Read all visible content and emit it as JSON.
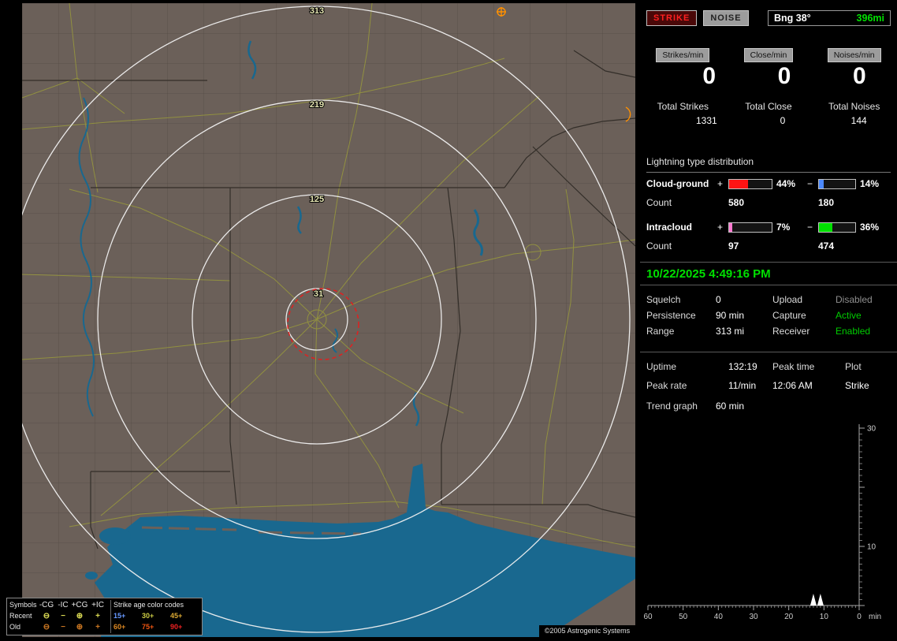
{
  "panel": {
    "strike_button": "STRIKE",
    "noise_button": "NOISE",
    "bearing": {
      "label": "Bng 38°",
      "distance": "396mi"
    },
    "rates": [
      {
        "label": "Strikes/min",
        "value": "0"
      },
      {
        "label": "Close/min",
        "value": "0"
      },
      {
        "label": "Noises/min",
        "value": "0"
      }
    ],
    "totals": [
      {
        "label": "Total Strikes",
        "value": "1331"
      },
      {
        "label": "Total Close",
        "value": "0"
      },
      {
        "label": "Total Noises",
        "value": "144"
      }
    ],
    "distribution": {
      "title": "Lightning type distribution",
      "plus": "+",
      "minus": "−",
      "rows": [
        {
          "label": "Cloud-ground",
          "pos_pct": "44%",
          "pos_fill": 44,
          "pos_color": "#ff1414",
          "neg_pct": "14%",
          "neg_fill": 14,
          "neg_color": "#4d8aff",
          "count_label": "Count",
          "pos_count": "580",
          "neg_count": "180"
        },
        {
          "label": "Intracloud",
          "pos_pct": "7%",
          "pos_fill": 7,
          "pos_color": "#ff7ad2",
          "neg_pct": "36%",
          "neg_fill": 36,
          "neg_color": "#00e000",
          "count_label": "Count",
          "pos_count": "97",
          "neg_count": "474"
        }
      ]
    },
    "datetime": "10/22/2025 4:49:16 PM",
    "status": {
      "rows": [
        {
          "label": "Squelch",
          "value": "0",
          "label2": "Upload",
          "value2": "Disabled",
          "value2_color": "#8f8f8f"
        },
        {
          "label": "Persistence",
          "value": "90 min",
          "label2": "Capture",
          "value2": "Active",
          "value2_color": "#00cc00"
        },
        {
          "label": "Range",
          "value": "313 mi",
          "label2": "Receiver",
          "value2": "Enabled",
          "value2_color": "#00cc00"
        }
      ]
    },
    "stats": {
      "row1": [
        "Uptime",
        "132:19",
        "Peak time",
        "Plot"
      ],
      "row2": [
        "Peak rate",
        "11/min",
        "12:06 AM",
        "Strike"
      ]
    },
    "trend": {
      "label": "Trend graph",
      "value": "60 min"
    }
  },
  "chart_data": {
    "type": "line",
    "title": "Strike rate trend (last 60 min)",
    "x_tick_labels": [
      "60",
      "50",
      "40",
      "30",
      "20",
      "10",
      "0"
    ],
    "x_unit": "min",
    "y_tick_labels": [
      "30",
      "10"
    ],
    "y_range": [
      0,
      30
    ],
    "axes_color": "#a8a8a8",
    "grid": false,
    "series": [
      {
        "name": "Strikes/min",
        "points_min_ago_value": [
          [
            13,
            2
          ],
          [
            11,
            2
          ]
        ],
        "note": "flat at 0 across the hour except two small spikes near 11-13 minutes ago"
      }
    ]
  },
  "map": {
    "ring_labels": [
      "313",
      "219",
      "125",
      "31"
    ],
    "copyright": "©2005 Astrogenic Systems",
    "legend": {
      "symbols_header": "Symbols",
      "columns": [
        "-CG",
        "-IC",
        "+CG",
        "+IC"
      ],
      "age_header": "Strike age color codes",
      "rows": [
        {
          "label": "Recent",
          "symbols": [
            "⊖",
            "−",
            "⊕",
            "+"
          ],
          "symbol_color": "#dddd55",
          "ages": [
            {
              "text": "15+",
              "color": "#6699ff"
            },
            {
              "text": "30+",
              "color": "#cccc44"
            },
            {
              "text": "45+",
              "color": "#ddaa33"
            }
          ]
        },
        {
          "label": "Old",
          "symbols": [
            "⊖",
            "−",
            "⊕",
            "+"
          ],
          "symbol_color": "#cc7722",
          "ages": [
            {
              "text": "60+",
              "color": "#dd8822"
            },
            {
              "text": "75+",
              "color": "#ee5511"
            },
            {
              "text": "90+",
              "color": "#ee2222"
            }
          ]
        }
      ]
    }
  }
}
